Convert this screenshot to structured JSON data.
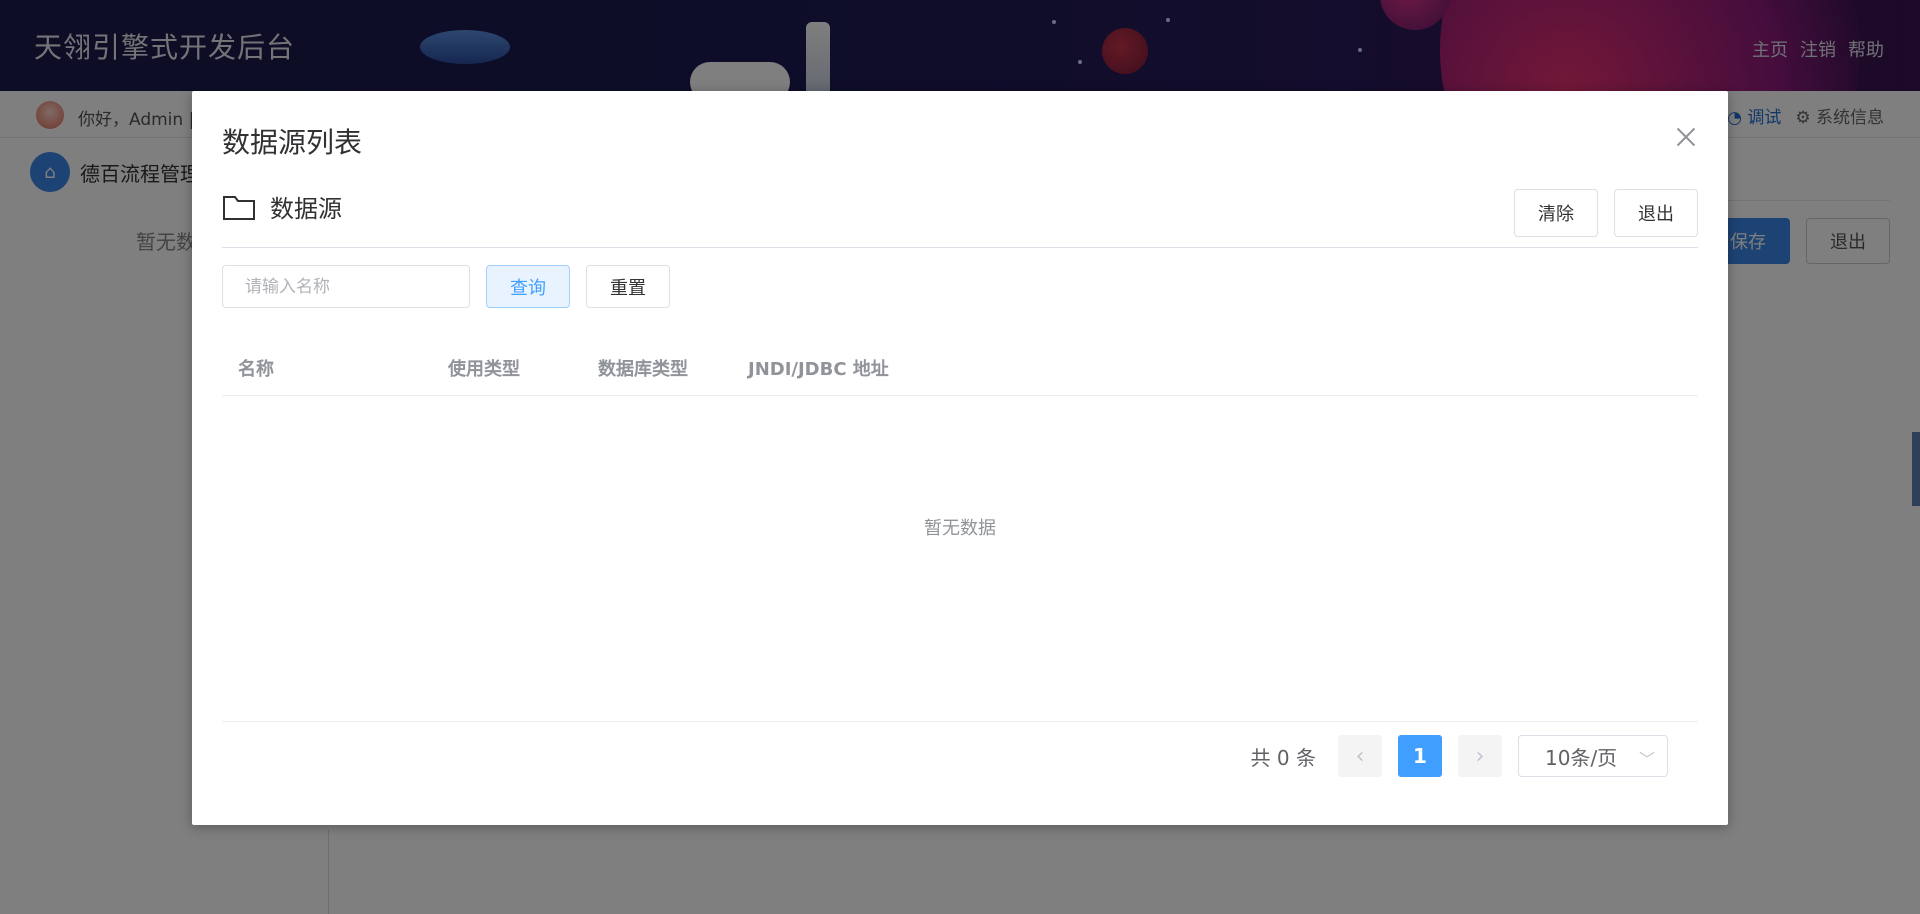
{
  "app": {
    "title": "天翎引擎式开发后台",
    "nav": [
      "主页",
      "注销",
      "帮助"
    ]
  },
  "userbar": {
    "greeting": "你好，Admin |",
    "debug": "调试",
    "sysinfo": "系统信息"
  },
  "breadcrumb": {
    "text": "德百流程管理"
  },
  "background": {
    "empty_text": "暂无数",
    "save": "保存",
    "exit": "退出"
  },
  "dialog": {
    "title": "数据源列表",
    "section_title": "数据源",
    "clear_label": "清除",
    "exit_label": "退出",
    "search": {
      "placeholder": "请输入名称",
      "value": ""
    },
    "query_label": "查询",
    "reset_label": "重置",
    "table": {
      "columns": [
        "名称",
        "使用类型",
        "数据库类型",
        "JNDI/JDBC 地址"
      ],
      "rows": [],
      "empty_text": "暂无数据"
    },
    "pagination": {
      "total": "共 0 条",
      "current_page": "1",
      "page_size": "10条/页"
    }
  },
  "colors": {
    "primary": "#409eff",
    "header_bg": "#1e1a55",
    "overlay": "rgba(0,0,0,0.5)"
  }
}
